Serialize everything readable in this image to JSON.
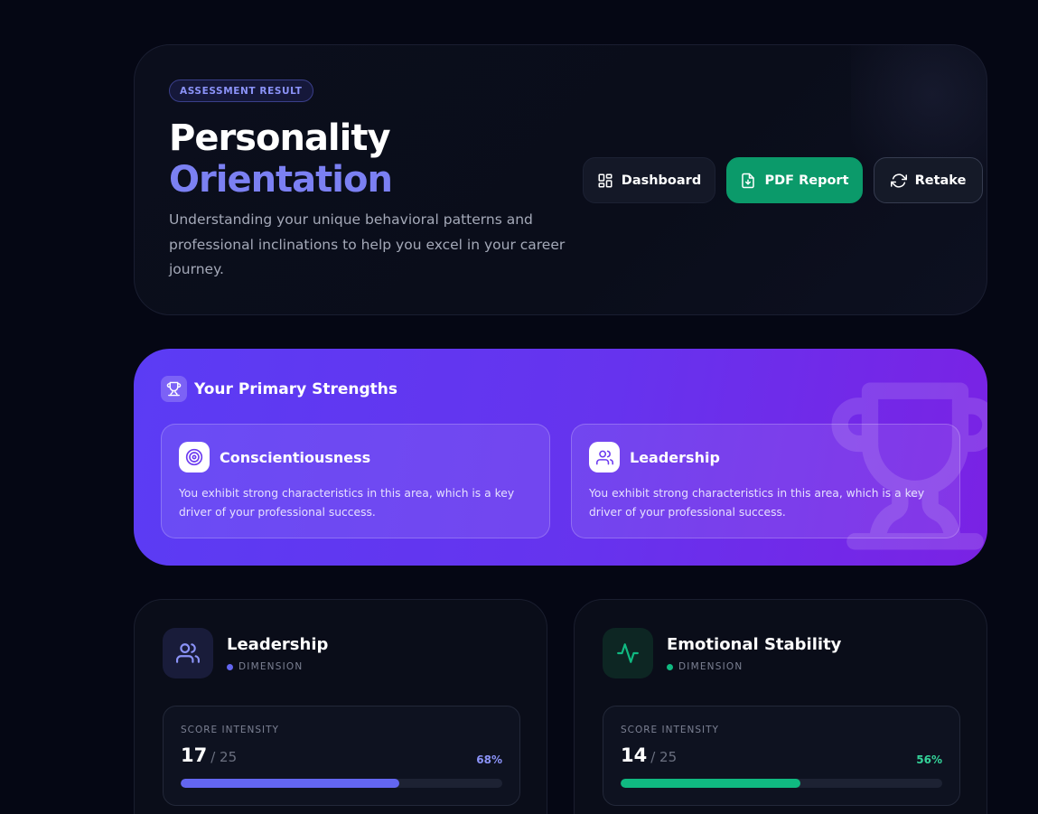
{
  "hero": {
    "badge": "ASSESSMENT RESULT",
    "title_line1": "Personality",
    "title_line2": "Orientation",
    "subtitle": "Understanding your unique behavioral patterns and professional inclinations to help you excel in your career journey.",
    "buttons": {
      "dashboard": {
        "label": "Dashboard",
        "icon": "grid-icon"
      },
      "pdf": {
        "label": "PDF Report",
        "icon": "file-download-icon"
      },
      "retake": {
        "label": "Retake",
        "icon": "refresh-icon"
      }
    }
  },
  "strengths": {
    "title": "Your Primary Strengths",
    "icon": "trophy-icon",
    "items": [
      {
        "name": "Conscientiousness",
        "icon": "target-icon",
        "description": "You exhibit strong characteristics in this area, which is a key driver of your professional success."
      },
      {
        "name": "Leadership",
        "icon": "users-icon",
        "description": "You exhibit strong characteristics in this area, which is a key driver of your professional success."
      }
    ]
  },
  "dimensions": [
    {
      "name": "Leadership",
      "tag": "DIMENSION",
      "icon": "users-icon",
      "score_label": "SCORE INTENSITY",
      "score": "17",
      "max": "/ 25",
      "percent_text": "68%",
      "percent": 68,
      "color": "#6366f1",
      "pct_color": "#8b93f8"
    },
    {
      "name": "Emotional Stability",
      "tag": "DIMENSION",
      "icon": "activity-icon",
      "score_label": "SCORE INTENSITY",
      "score": "14",
      "max": "/ 25",
      "percent_text": "56%",
      "percent": 56,
      "color": "#10b981",
      "pct_color": "#34d399"
    }
  ],
  "colors": {
    "background": "#050714",
    "accent": "#7b80f2",
    "success": "#0b9a6a"
  }
}
